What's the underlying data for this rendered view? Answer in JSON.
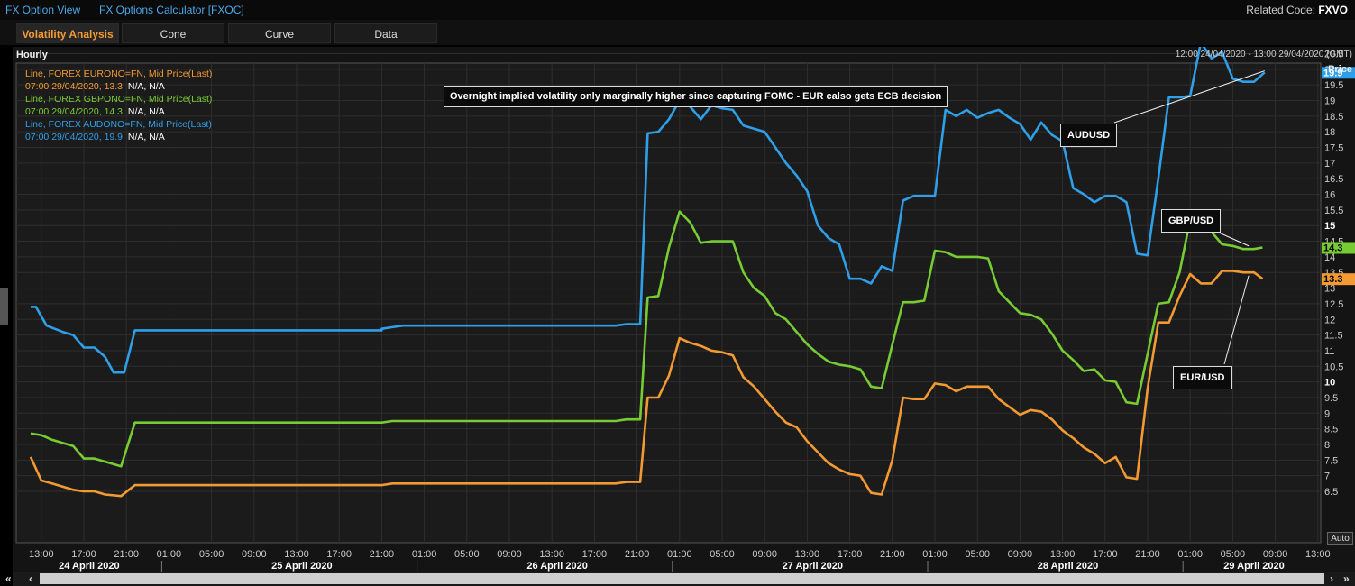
{
  "topbar": {
    "link1": "FX Option View",
    "link2": "FX Options Calculator [FXOC]",
    "related_label": "Related Code:",
    "related_code": "FXVO"
  },
  "tabs": [
    "Volatility Analysis",
    "Cone",
    "Curve",
    "Data"
  ],
  "chart_header": {
    "interval": "Hourly",
    "range": "12:00 24/04/2020 - 13:00 29/04/2020 (GMT)",
    "price_label": "Price",
    "auto_label": "Auto"
  },
  "legend": [
    {
      "title": "Line, FOREX EURONO=FN, Mid Price(Last)",
      "time": "07:00 29/04/2020, 13.3,",
      "extra": " N/A, N/A",
      "color": "#f39a32"
    },
    {
      "title": "Line, FOREX GBPONO=FN, Mid Price(Last)",
      "time": "07:00 29/04/2020, 14.3,",
      "extra": " N/A, N/A",
      "color": "#77cc33"
    },
    {
      "title": "Line, FOREX AUDONO=FN, Mid Price(Last)",
      "time": "07:00 29/04/2020, 19.9,",
      "extra": " N/A, N/A",
      "color": "#2f9fe9"
    }
  ],
  "annotations": {
    "headline": "Overnight implied volatility only marginally higher since capturing FOMC - EUR calso gets ECB decision",
    "aud": "AUDUSD",
    "gbp": "GBP/USD",
    "eur": "EUR/USD"
  },
  "chart_data": {
    "type": "line",
    "x_unit": "hours since 12:00 24/04/2020",
    "ylim": [
      6.0,
      21.0
    ],
    "y_ticks": [
      6.5,
      7,
      7.5,
      8,
      8.5,
      9,
      9.5,
      10,
      10.5,
      11,
      11.5,
      12,
      12.5,
      13,
      13.5,
      14,
      14.5,
      15,
      15.5,
      16,
      16.5,
      17,
      17.5,
      18,
      18.5,
      19,
      19.5,
      20,
      20.5
    ],
    "y_major": [
      10,
      15,
      20
    ],
    "x_ticks": [
      {
        "h": 1,
        "label": "13:00"
      },
      {
        "h": 5,
        "label": "17:00"
      },
      {
        "h": 9,
        "label": "21:00"
      },
      {
        "h": 13,
        "label": "01:00"
      },
      {
        "h": 17,
        "label": "05:00"
      },
      {
        "h": 21,
        "label": "09:00"
      },
      {
        "h": 25,
        "label": "13:00"
      },
      {
        "h": 29,
        "label": "17:00"
      },
      {
        "h": 33,
        "label": "21:00"
      },
      {
        "h": 37,
        "label": "01:00"
      },
      {
        "h": 41,
        "label": "05:00"
      },
      {
        "h": 45,
        "label": "09:00"
      },
      {
        "h": 49,
        "label": "13:00"
      },
      {
        "h": 53,
        "label": "17:00"
      },
      {
        "h": 57,
        "label": "21:00"
      },
      {
        "h": 61,
        "label": "01:00"
      },
      {
        "h": 65,
        "label": "05:00"
      },
      {
        "h": 69,
        "label": "09:00"
      },
      {
        "h": 73,
        "label": "13:00"
      },
      {
        "h": 77,
        "label": "17:00"
      },
      {
        "h": 81,
        "label": "21:00"
      },
      {
        "h": 85,
        "label": "01:00"
      },
      {
        "h": 89,
        "label": "05:00"
      },
      {
        "h": 93,
        "label": "09:00"
      },
      {
        "h": 97,
        "label": "13:00"
      },
      {
        "h": 101,
        "label": "17:00"
      },
      {
        "h": 105,
        "label": "21:00"
      },
      {
        "h": 109,
        "label": "01:00"
      },
      {
        "h": 113,
        "label": "05:00"
      },
      {
        "h": 117,
        "label": "09:00"
      },
      {
        "h": 121,
        "label": "13:00"
      }
    ],
    "date_labels": [
      {
        "h": 5.5,
        "label": "24 April 2020"
      },
      {
        "h": 25.5,
        "label": "25 April 2020"
      },
      {
        "h": 49.5,
        "label": "26 April 2020"
      },
      {
        "h": 73.5,
        "label": "27 April 2020"
      },
      {
        "h": 97.5,
        "label": "28 April 2020"
      },
      {
        "h": 115,
        "label": "29 April 2020"
      }
    ],
    "date_separators": [
      13,
      37,
      61,
      85,
      109
    ],
    "series": [
      {
        "name": "AUDUSD",
        "color": "#2f9fe9",
        "last": 19.9,
        "points": [
          [
            0,
            12.4
          ],
          [
            0.5,
            12.4
          ],
          [
            1.5,
            11.8
          ],
          [
            3,
            11.6
          ],
          [
            4,
            11.5
          ],
          [
            5,
            11.1
          ],
          [
            6,
            11.1
          ],
          [
            7,
            10.8
          ],
          [
            7.8,
            10.3
          ],
          [
            8.8,
            10.3
          ],
          [
            9.8,
            11.65
          ],
          [
            33,
            11.65
          ],
          [
            33,
            11.7
          ],
          [
            34,
            11.75
          ],
          [
            35,
            11.8
          ],
          [
            55,
            11.8
          ],
          [
            56,
            11.85
          ],
          [
            57.3,
            11.85
          ],
          [
            58,
            17.95
          ],
          [
            59,
            18
          ],
          [
            60,
            18.4
          ],
          [
            61,
            19
          ],
          [
            62,
            18.8
          ],
          [
            63,
            18.4
          ],
          [
            64,
            18.85
          ],
          [
            65,
            18.75
          ],
          [
            66,
            18.7
          ],
          [
            67,
            18.2
          ],
          [
            68,
            18.1
          ],
          [
            69,
            18
          ],
          [
            70,
            17.5
          ],
          [
            71,
            17
          ],
          [
            72,
            16.6
          ],
          [
            73,
            16.1
          ],
          [
            74,
            15
          ],
          [
            75,
            14.6
          ],
          [
            76,
            14.4
          ],
          [
            77,
            13.3
          ],
          [
            78,
            13.3
          ],
          [
            79,
            13.15
          ],
          [
            80,
            13.7
          ],
          [
            81,
            13.55
          ],
          [
            82,
            15.8
          ],
          [
            83,
            15.95
          ],
          [
            84,
            15.95
          ],
          [
            85,
            15.95
          ],
          [
            86,
            18.7
          ],
          [
            87,
            18.5
          ],
          [
            88,
            18.7
          ],
          [
            89,
            18.45
          ],
          [
            90,
            18.6
          ],
          [
            91,
            18.7
          ],
          [
            92,
            18.45
          ],
          [
            93,
            18.25
          ],
          [
            94,
            17.75
          ],
          [
            95,
            18.3
          ],
          [
            96,
            17.9
          ],
          [
            97,
            17.7
          ],
          [
            98,
            16.2
          ],
          [
            99,
            16
          ],
          [
            100,
            15.75
          ],
          [
            101,
            15.95
          ],
          [
            102,
            15.95
          ],
          [
            103,
            15.75
          ],
          [
            104,
            14.1
          ],
          [
            105,
            14.05
          ],
          [
            106,
            16.5
          ],
          [
            107,
            19.1
          ],
          [
            108,
            19.1
          ],
          [
            109,
            19.15
          ],
          [
            110,
            20.85
          ],
          [
            111,
            20.35
          ],
          [
            112,
            20.55
          ],
          [
            113,
            19.7
          ],
          [
            114,
            19.6
          ],
          [
            115,
            19.6
          ],
          [
            116,
            19.9
          ]
        ]
      },
      {
        "name": "GBP/USD",
        "color": "#77cc33",
        "last": 14.3,
        "points": [
          [
            0,
            8.35
          ],
          [
            1,
            8.3
          ],
          [
            2,
            8.15
          ],
          [
            3,
            8.05
          ],
          [
            4,
            7.95
          ],
          [
            5,
            7.55
          ],
          [
            6,
            7.55
          ],
          [
            7,
            7.45
          ],
          [
            8.5,
            7.3
          ],
          [
            9.8,
            8.7
          ],
          [
            33,
            8.7
          ],
          [
            34,
            8.75
          ],
          [
            55,
            8.75
          ],
          [
            56,
            8.8
          ],
          [
            57.3,
            8.8
          ],
          [
            58,
            12.7
          ],
          [
            59,
            12.75
          ],
          [
            60,
            14.3
          ],
          [
            61,
            15.45
          ],
          [
            62,
            15.1
          ],
          [
            63,
            14.45
          ],
          [
            64,
            14.5
          ],
          [
            65,
            14.5
          ],
          [
            66,
            14.5
          ],
          [
            67,
            13.5
          ],
          [
            68,
            13
          ],
          [
            69,
            12.75
          ],
          [
            70,
            12.2
          ],
          [
            71,
            12
          ],
          [
            72,
            11.6
          ],
          [
            73,
            11.2
          ],
          [
            74,
            10.9
          ],
          [
            75,
            10.65
          ],
          [
            76,
            10.55
          ],
          [
            77,
            10.5
          ],
          [
            78,
            10.4
          ],
          [
            79,
            9.85
          ],
          [
            80,
            9.8
          ],
          [
            81,
            11.2
          ],
          [
            82,
            12.55
          ],
          [
            83,
            12.55
          ],
          [
            84,
            12.6
          ],
          [
            85,
            14.2
          ],
          [
            86,
            14.15
          ],
          [
            87,
            14
          ],
          [
            88,
            14
          ],
          [
            89,
            14
          ],
          [
            90,
            13.95
          ],
          [
            91,
            12.9
          ],
          [
            92,
            12.55
          ],
          [
            93,
            12.2
          ],
          [
            94,
            12.15
          ],
          [
            95,
            12
          ],
          [
            96,
            11.55
          ],
          [
            97,
            11
          ],
          [
            98,
            10.7
          ],
          [
            99,
            10.35
          ],
          [
            100,
            10.4
          ],
          [
            101,
            10.05
          ],
          [
            102,
            10
          ],
          [
            103,
            9.35
          ],
          [
            104,
            9.3
          ],
          [
            105,
            10.9
          ],
          [
            106,
            12.5
          ],
          [
            107,
            12.55
          ],
          [
            108,
            13.5
          ],
          [
            109,
            15.2
          ],
          [
            110,
            14.9
          ],
          [
            111,
            14.8
          ],
          [
            112,
            14.4
          ],
          [
            113,
            14.35
          ],
          [
            114,
            14.25
          ],
          [
            115,
            14.25
          ],
          [
            115.8,
            14.3
          ]
        ]
      },
      {
        "name": "EUR/USD",
        "color": "#f39a32",
        "last": 13.3,
        "points": [
          [
            0,
            7.6
          ],
          [
            1,
            6.85
          ],
          [
            2,
            6.75
          ],
          [
            3,
            6.65
          ],
          [
            4,
            6.55
          ],
          [
            5,
            6.5
          ],
          [
            6,
            6.5
          ],
          [
            7,
            6.4
          ],
          [
            8.5,
            6.35
          ],
          [
            9.8,
            6.7
          ],
          [
            33,
            6.7
          ],
          [
            34,
            6.75
          ],
          [
            55,
            6.75
          ],
          [
            56,
            6.8
          ],
          [
            57.3,
            6.8
          ],
          [
            58,
            9.5
          ],
          [
            59,
            9.5
          ],
          [
            60,
            10.2
          ],
          [
            61,
            11.4
          ],
          [
            62,
            11.25
          ],
          [
            63,
            11.15
          ],
          [
            64,
            11
          ],
          [
            65,
            10.95
          ],
          [
            66,
            10.85
          ],
          [
            67,
            10.15
          ],
          [
            68,
            9.85
          ],
          [
            69,
            9.45
          ],
          [
            70,
            9.05
          ],
          [
            71,
            8.7
          ],
          [
            72,
            8.55
          ],
          [
            73,
            8.1
          ],
          [
            74,
            7.75
          ],
          [
            75,
            7.4
          ],
          [
            76,
            7.2
          ],
          [
            77,
            7.05
          ],
          [
            78,
            7
          ],
          [
            79,
            6.45
          ],
          [
            80,
            6.4
          ],
          [
            81,
            7.5
          ],
          [
            82,
            9.5
          ],
          [
            83,
            9.45
          ],
          [
            84,
            9.45
          ],
          [
            85,
            9.95
          ],
          [
            86,
            9.9
          ],
          [
            87,
            9.7
          ],
          [
            88,
            9.85
          ],
          [
            89,
            9.85
          ],
          [
            90,
            9.85
          ],
          [
            91,
            9.45
          ],
          [
            92,
            9.2
          ],
          [
            93,
            8.95
          ],
          [
            94,
            9.1
          ],
          [
            95,
            9.05
          ],
          [
            96,
            8.8
          ],
          [
            97,
            8.45
          ],
          [
            98,
            8.2
          ],
          [
            99,
            7.9
          ],
          [
            100,
            7.7
          ],
          [
            101,
            7.4
          ],
          [
            102,
            7.6
          ],
          [
            103,
            6.95
          ],
          [
            104,
            6.9
          ],
          [
            105,
            9.8
          ],
          [
            106,
            11.9
          ],
          [
            107,
            11.9
          ],
          [
            108,
            12.75
          ],
          [
            109,
            13.45
          ],
          [
            110,
            13.15
          ],
          [
            111,
            13.15
          ],
          [
            112,
            13.55
          ],
          [
            113,
            13.55
          ],
          [
            114,
            13.5
          ],
          [
            115,
            13.5
          ],
          [
            115.8,
            13.3
          ]
        ]
      }
    ]
  },
  "scrollbar": {
    "first": "«",
    "prev": "‹",
    "next": "›",
    "last": "»"
  }
}
